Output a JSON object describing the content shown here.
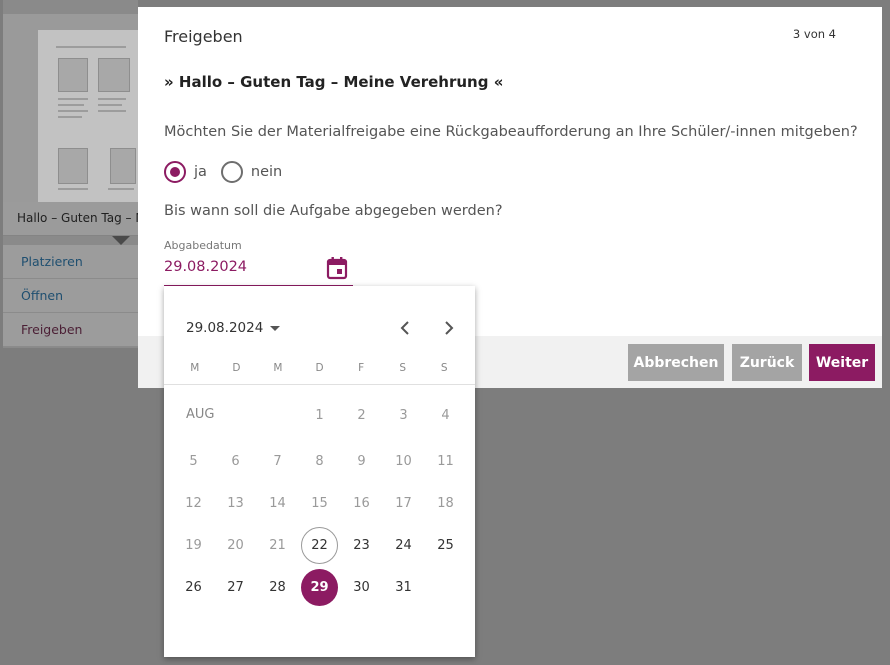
{
  "background": {
    "card_title": "Hallo – Guten Tag – Meine Verehrung",
    "menu": [
      "Platzieren",
      "Öffnen",
      "Freigeben"
    ]
  },
  "dialog": {
    "title": "Freigeben",
    "step": "3 von 4",
    "subtitle": "» Hallo – Guten Tag – Meine Verehrung «",
    "question": "Möchten Sie der Materialfreigabe eine Rückgabeaufforderung an Ihre Schüler/-innen mitgeben?",
    "radio_yes": "ja",
    "radio_no": "nein",
    "selected_radio": "ja",
    "due_question": "Bis wann soll die Aufgabe abgegeben werden?",
    "date_label": "Abgabedatum",
    "date_value": "29.08.2024",
    "calendar_icon": "calendar-icon",
    "buttons": {
      "cancel": "Abbrechen",
      "back": "Zurück",
      "next": "Weiter"
    }
  },
  "datepicker": {
    "header": "29.08.2024",
    "weekdays": [
      "M",
      "D",
      "M",
      "D",
      "F",
      "S",
      "S"
    ],
    "month_label": "AUG",
    "weeks": [
      [
        null,
        null,
        null,
        1,
        2,
        3,
        4
      ],
      [
        5,
        6,
        7,
        8,
        9,
        10,
        11
      ],
      [
        12,
        13,
        14,
        15,
        16,
        17,
        18
      ],
      [
        19,
        20,
        21,
        22,
        23,
        24,
        25
      ],
      [
        26,
        27,
        28,
        29,
        30,
        31,
        null
      ]
    ],
    "today": 22,
    "selected": 29,
    "disabled_before": 22
  },
  "colors": {
    "accent": "#8c1b62",
    "button_grey": "#a4a4a4",
    "backdrop": "#7d7d7d"
  }
}
